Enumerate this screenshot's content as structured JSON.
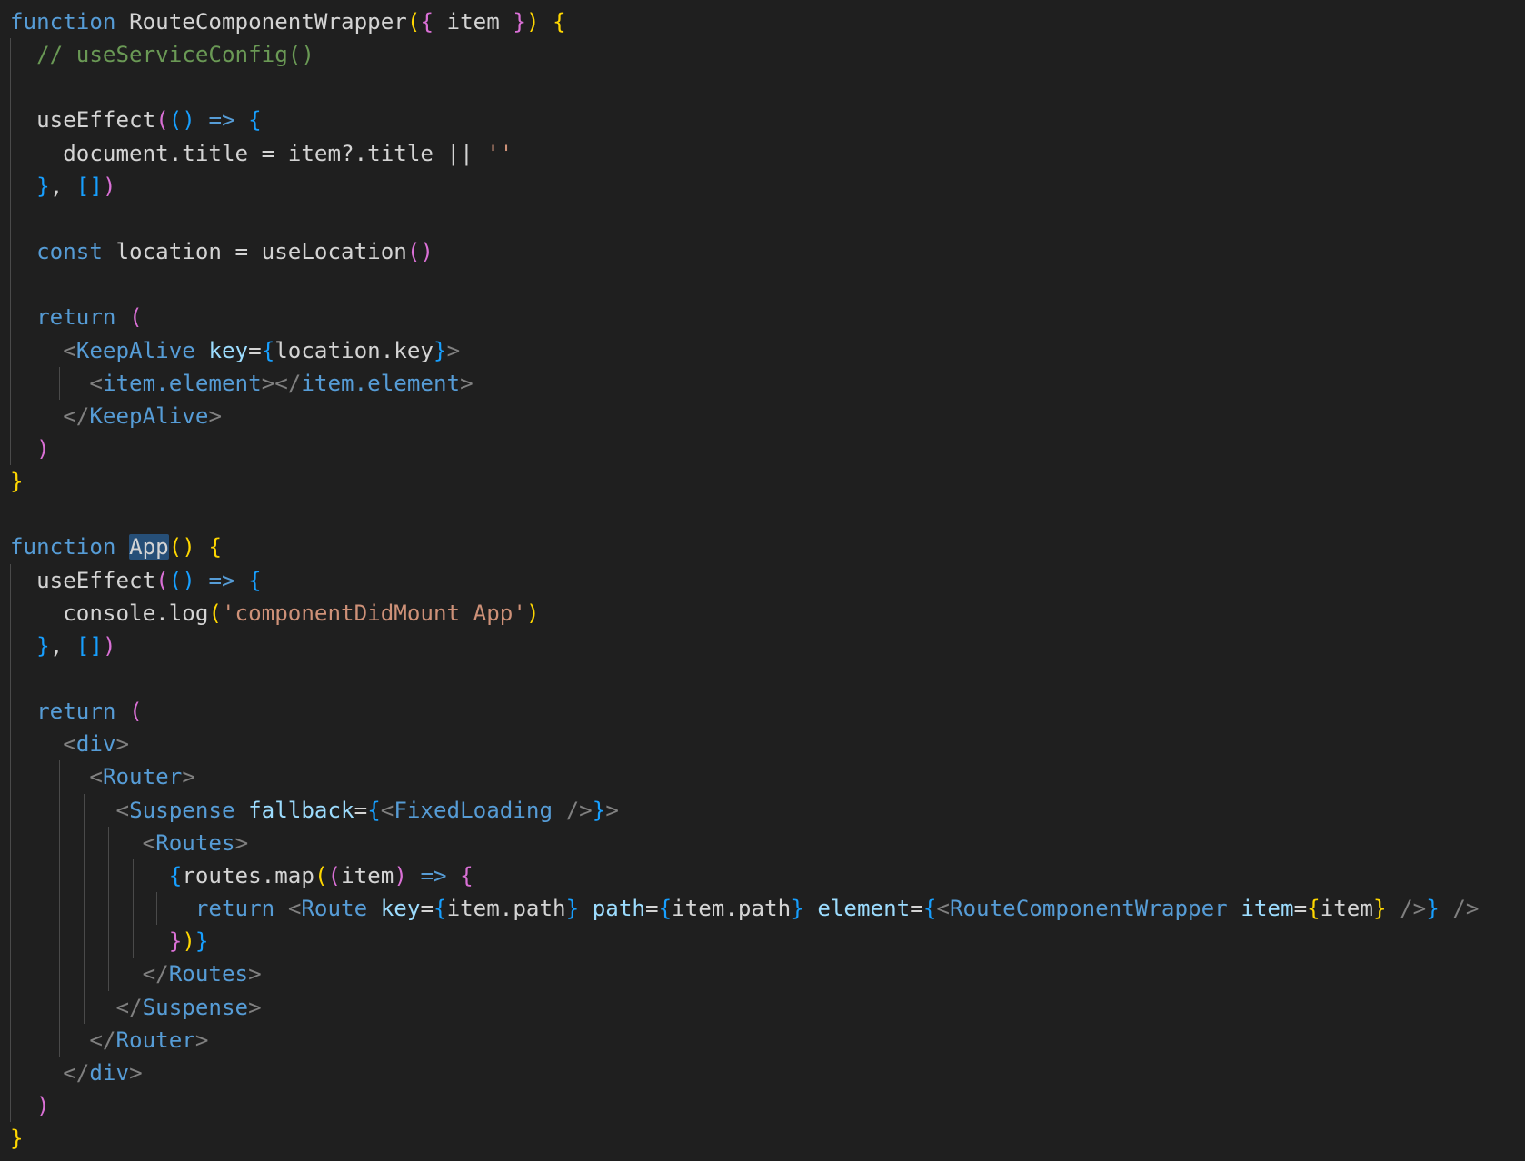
{
  "theme": {
    "background": "#1f1f1f",
    "keyword": "#569cd6",
    "comment": "#6a9955",
    "string": "#ce9178",
    "variable": "#9cdcfe",
    "bracket_gold": "#ffd700",
    "bracket_purple": "#da70d6",
    "bracket_blue": "#179fff",
    "selection": "#264f78"
  },
  "code": {
    "lines": [
      [
        [
          "kw",
          "function"
        ],
        [
          "pl",
          " "
        ],
        [
          "pl",
          "RouteComponentWrapper"
        ],
        [
          "br1",
          "("
        ],
        [
          "br2",
          "{"
        ],
        [
          "pl",
          " item "
        ],
        [
          "br2",
          "}"
        ],
        [
          "br1",
          ")"
        ],
        [
          "pl",
          " "
        ],
        [
          "br1",
          "{"
        ]
      ],
      [
        [
          "pl",
          "  "
        ],
        [
          "cm",
          "// useServiceConfig()"
        ]
      ],
      [],
      [
        [
          "pl",
          "  useEffect"
        ],
        [
          "br2",
          "("
        ],
        [
          "br3",
          "()"
        ],
        [
          "pl",
          " "
        ],
        [
          "kw",
          "=>"
        ],
        [
          "pl",
          " "
        ],
        [
          "br3",
          "{"
        ]
      ],
      [
        [
          "pl",
          "    document.title = item?.title || "
        ],
        [
          "str",
          "''"
        ]
      ],
      [
        [
          "pl",
          "  "
        ],
        [
          "br3",
          "}"
        ],
        [
          "pl",
          ", "
        ],
        [
          "br3",
          "[]"
        ],
        [
          "br2",
          ")"
        ]
      ],
      [],
      [
        [
          "pl",
          "  "
        ],
        [
          "kw",
          "const"
        ],
        [
          "pl",
          " location = useLocation"
        ],
        [
          "br2",
          "()"
        ]
      ],
      [],
      [
        [
          "pl",
          "  "
        ],
        [
          "kw",
          "return"
        ],
        [
          "pl",
          " "
        ],
        [
          "br2",
          "("
        ]
      ],
      [
        [
          "pl",
          "    "
        ],
        [
          "tp",
          "<"
        ],
        [
          "tag",
          "KeepAlive"
        ],
        [
          "pl",
          " "
        ],
        [
          "var",
          "key"
        ],
        [
          "pl",
          "="
        ],
        [
          "br3",
          "{"
        ],
        [
          "pl",
          "location.key"
        ],
        [
          "br3",
          "}"
        ],
        [
          "tp",
          ">"
        ]
      ],
      [
        [
          "pl",
          "      "
        ],
        [
          "tp",
          "<"
        ],
        [
          "tag",
          "item.element"
        ],
        [
          "tp",
          "></"
        ],
        [
          "tag",
          "item.element"
        ],
        [
          "tp",
          ">"
        ]
      ],
      [
        [
          "pl",
          "    "
        ],
        [
          "tp",
          "</"
        ],
        [
          "tag",
          "KeepAlive"
        ],
        [
          "tp",
          ">"
        ]
      ],
      [
        [
          "pl",
          "  "
        ],
        [
          "br2",
          ")"
        ]
      ],
      [
        [
          "br1",
          "}"
        ]
      ],
      [],
      [
        [
          "kw",
          "function"
        ],
        [
          "pl",
          " "
        ],
        [
          "hl",
          "App"
        ],
        [
          "br1",
          "()"
        ],
        [
          "pl",
          " "
        ],
        [
          "br1",
          "{"
        ]
      ],
      [
        [
          "pl",
          "  useEffect"
        ],
        [
          "br2",
          "("
        ],
        [
          "br3",
          "()"
        ],
        [
          "pl",
          " "
        ],
        [
          "kw",
          "=>"
        ],
        [
          "pl",
          " "
        ],
        [
          "br3",
          "{"
        ]
      ],
      [
        [
          "pl",
          "    console.log"
        ],
        [
          "br1",
          "("
        ],
        [
          "str",
          "'componentDidMount App'"
        ],
        [
          "br1",
          ")"
        ]
      ],
      [
        [
          "pl",
          "  "
        ],
        [
          "br3",
          "}"
        ],
        [
          "pl",
          ", "
        ],
        [
          "br3",
          "[]"
        ],
        [
          "br2",
          ")"
        ]
      ],
      [],
      [
        [
          "pl",
          "  "
        ],
        [
          "kw",
          "return"
        ],
        [
          "pl",
          " "
        ],
        [
          "br2",
          "("
        ]
      ],
      [
        [
          "pl",
          "    "
        ],
        [
          "tp",
          "<"
        ],
        [
          "tag",
          "div"
        ],
        [
          "tp",
          ">"
        ]
      ],
      [
        [
          "pl",
          "      "
        ],
        [
          "tp",
          "<"
        ],
        [
          "tag",
          "Router"
        ],
        [
          "tp",
          ">"
        ]
      ],
      [
        [
          "pl",
          "        "
        ],
        [
          "tp",
          "<"
        ],
        [
          "tag",
          "Suspense"
        ],
        [
          "pl",
          " "
        ],
        [
          "var",
          "fallback"
        ],
        [
          "pl",
          "="
        ],
        [
          "br3",
          "{"
        ],
        [
          "tp",
          "<"
        ],
        [
          "tag",
          "FixedLoading"
        ],
        [
          "pl",
          " "
        ],
        [
          "tp",
          "/>"
        ],
        [
          "br3",
          "}"
        ],
        [
          "tp",
          ">"
        ]
      ],
      [
        [
          "pl",
          "          "
        ],
        [
          "tp",
          "<"
        ],
        [
          "tag",
          "Routes"
        ],
        [
          "tp",
          ">"
        ]
      ],
      [
        [
          "pl",
          "            "
        ],
        [
          "br3",
          "{"
        ],
        [
          "pl",
          "routes.map"
        ],
        [
          "br1",
          "("
        ],
        [
          "br2",
          "("
        ],
        [
          "pl",
          "item"
        ],
        [
          "br2",
          ")"
        ],
        [
          "pl",
          " "
        ],
        [
          "kw",
          "=>"
        ],
        [
          "pl",
          " "
        ],
        [
          "br2",
          "{"
        ]
      ],
      [
        [
          "pl",
          "              "
        ],
        [
          "kw",
          "return"
        ],
        [
          "pl",
          " "
        ],
        [
          "tp",
          "<"
        ],
        [
          "tag",
          "Route"
        ],
        [
          "pl",
          " "
        ],
        [
          "var",
          "key"
        ],
        [
          "pl",
          "="
        ],
        [
          "br3",
          "{"
        ],
        [
          "pl",
          "item.path"
        ],
        [
          "br3",
          "}"
        ],
        [
          "pl",
          " "
        ],
        [
          "var",
          "path"
        ],
        [
          "pl",
          "="
        ],
        [
          "br3",
          "{"
        ],
        [
          "pl",
          "item.path"
        ],
        [
          "br3",
          "}"
        ],
        [
          "pl",
          " "
        ],
        [
          "var",
          "element"
        ],
        [
          "pl",
          "="
        ],
        [
          "br3",
          "{"
        ],
        [
          "tp",
          "<"
        ],
        [
          "tag",
          "RouteComponentWrapper"
        ],
        [
          "pl",
          " "
        ],
        [
          "var",
          "item"
        ],
        [
          "pl",
          "="
        ],
        [
          "br1",
          "{"
        ],
        [
          "pl",
          "item"
        ],
        [
          "br1",
          "}"
        ],
        [
          "pl",
          " "
        ],
        [
          "tp",
          "/>"
        ],
        [
          "br3",
          "}"
        ],
        [
          "pl",
          " "
        ],
        [
          "tp",
          "/>"
        ]
      ],
      [
        [
          "pl",
          "            "
        ],
        [
          "br2",
          "}"
        ],
        [
          "br1",
          ")"
        ],
        [
          "br3",
          "}"
        ]
      ],
      [
        [
          "pl",
          "          "
        ],
        [
          "tp",
          "</"
        ],
        [
          "tag",
          "Routes"
        ],
        [
          "tp",
          ">"
        ]
      ],
      [
        [
          "pl",
          "        "
        ],
        [
          "tp",
          "</"
        ],
        [
          "tag",
          "Suspense"
        ],
        [
          "tp",
          ">"
        ]
      ],
      [
        [
          "pl",
          "      "
        ],
        [
          "tp",
          "</"
        ],
        [
          "tag",
          "Router"
        ],
        [
          "tp",
          ">"
        ]
      ],
      [
        [
          "pl",
          "    "
        ],
        [
          "tp",
          "</"
        ],
        [
          "tag",
          "div"
        ],
        [
          "tp",
          ">"
        ]
      ],
      [
        [
          "pl",
          "  "
        ],
        [
          "br2",
          ")"
        ]
      ],
      [
        [
          "br1",
          "}"
        ]
      ]
    ]
  }
}
